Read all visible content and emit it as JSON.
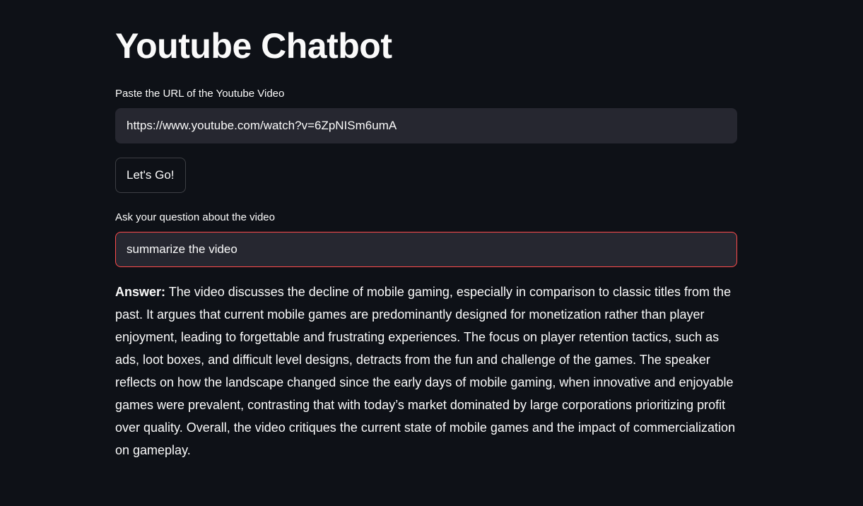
{
  "app": {
    "title": "Youtube Chatbot"
  },
  "url_field": {
    "label": "Paste the URL of the Youtube Video",
    "value": "https://www.youtube.com/watch?v=6ZpNISm6umA"
  },
  "submit_button": {
    "label": "Let's Go!"
  },
  "question_field": {
    "label": "Ask your question about the video",
    "value": "summarize the video"
  },
  "answer": {
    "prefix": "Answer:",
    "text": "The video discusses the decline of mobile gaming, especially in comparison to classic titles from the past. It argues that current mobile games are predominantly designed for monetization rather than player enjoyment, leading to forgettable and frustrating experiences. The focus on player retention tactics, such as ads, loot boxes, and difficult level designs, detracts from the fun and challenge of the games. The speaker reflects on how the landscape changed since the early days of mobile gaming, when innovative and enjoyable games were prevalent, contrasting that with today’s market dominated by large corporations prioritizing profit over quality. Overall, the video critiques the current state of mobile games and the impact of commercialization on gameplay."
  },
  "colors": {
    "background": "#0e1117",
    "input_background": "#262730",
    "focus_border": "#ff4b4b",
    "text": "#fafafa"
  }
}
